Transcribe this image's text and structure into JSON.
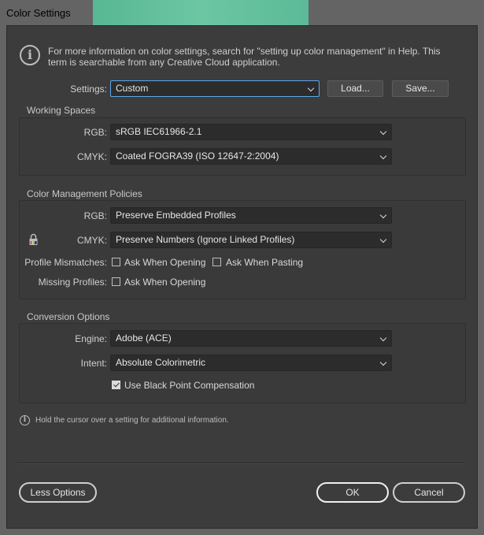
{
  "window": {
    "title": "Color Settings"
  },
  "info": {
    "text": "For more information on color settings, search for \"setting up color management\" in Help. This term is searchable from any Creative Cloud application."
  },
  "settings": {
    "label": "Settings:",
    "value": "Custom",
    "load_label": "Load...",
    "save_label": "Save..."
  },
  "working_spaces": {
    "title": "Working Spaces",
    "rgb_label": "RGB:",
    "rgb_value": "sRGB IEC61966-2.1",
    "cmyk_label": "CMYK:",
    "cmyk_value": "Coated FOGRA39 (ISO 12647-2:2004)"
  },
  "policies": {
    "title": "Color Management Policies",
    "rgb_label": "RGB:",
    "rgb_value": "Preserve Embedded Profiles",
    "cmyk_label": "CMYK:",
    "cmyk_value": "Preserve Numbers (Ignore Linked Profiles)",
    "mismatch_label": "Profile Mismatches:",
    "mismatch_opening_label": "Ask When Opening",
    "mismatch_opening_checked": false,
    "mismatch_pasting_label": "Ask When Pasting",
    "mismatch_pasting_checked": false,
    "missing_label": "Missing Profiles:",
    "missing_opening_label": "Ask When Opening",
    "missing_opening_checked": false
  },
  "conversion": {
    "title": "Conversion Options",
    "engine_label": "Engine:",
    "engine_value": "Adobe (ACE)",
    "intent_label": "Intent:",
    "intent_value": "Absolute Colorimetric",
    "bpc_label": "Use Black Point Compensation",
    "bpc_checked": true
  },
  "hint": {
    "text": "Hold the cursor over a setting for additional information."
  },
  "footer": {
    "less_options_label": "Less Options",
    "ok_label": "OK",
    "cancel_label": "Cancel"
  },
  "colors": {
    "accent": "#6cc6a3",
    "focus": "#5fa8e8",
    "background": "#3c3c3c"
  },
  "icons": {
    "info": "info-circle-icon",
    "lock": "lock-icon",
    "hint": "info-circle-icon",
    "dropdown": "chevron-down-icon"
  }
}
